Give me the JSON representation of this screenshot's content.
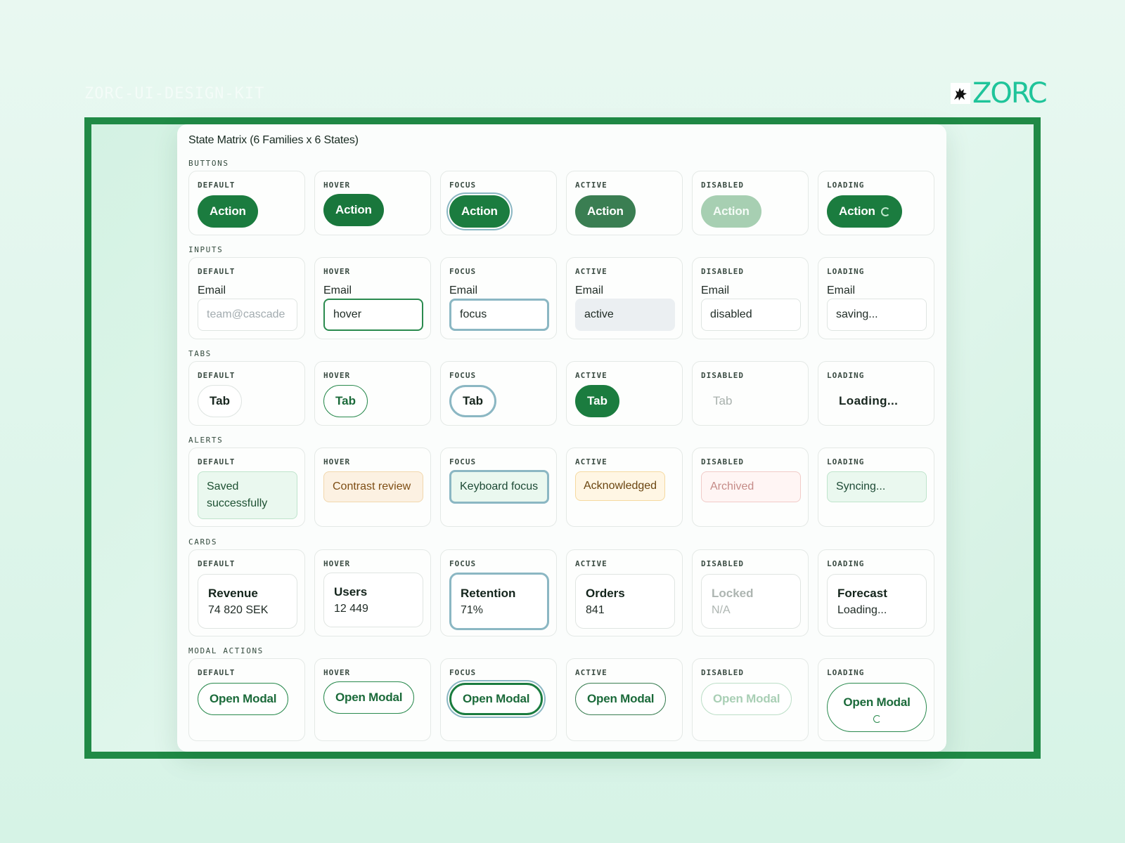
{
  "kit_title": "ZORC-UI-DESIGN-KIT",
  "logo": {
    "text": "ZORC",
    "icon": "creature-icon",
    "color": "#1fc49a"
  },
  "colors": {
    "frame": "#208a46",
    "primary": "#1b7c3f",
    "focus_ring": "#8bb7c3"
  },
  "matrix": {
    "title": "State Matrix (6 Families x 6 States)",
    "states": [
      "DEFAULT",
      "HOVER",
      "FOCUS",
      "ACTIVE",
      "DISABLED",
      "LOADING"
    ],
    "buttons": {
      "label": "BUTTONS",
      "items": [
        "Action",
        "Action",
        "Action",
        "Action",
        "Action",
        "Action"
      ]
    },
    "inputs": {
      "label": "INPUTS",
      "field_label": "Email",
      "placeholder": "team@cascade",
      "values": [
        "",
        "hover",
        "focus",
        "active",
        "disabled",
        "saving..."
      ]
    },
    "tabs": {
      "label": "TABS",
      "items": [
        "Tab",
        "Tab",
        "Tab",
        "Tab",
        "Tab",
        "Loading..."
      ]
    },
    "alerts": {
      "label": "ALERTS",
      "items": [
        "Saved successfully",
        "Contrast review",
        "Keyboard focus",
        "Acknowledged",
        "Archived",
        "Syncing..."
      ]
    },
    "cards": {
      "label": "CARDS",
      "items": [
        {
          "title": "Revenue",
          "value": "74 820 SEK"
        },
        {
          "title": "Users",
          "value": "12 449"
        },
        {
          "title": "Retention",
          "value": "71%"
        },
        {
          "title": "Orders",
          "value": "841"
        },
        {
          "title": "Locked",
          "value": "N/A"
        },
        {
          "title": "Forecast",
          "value": "Loading..."
        }
      ]
    },
    "modal_actions": {
      "label": "MODAL ACTIONS",
      "items": [
        "Open Modal",
        "Open Modal",
        "Open Modal",
        "Open Modal",
        "Open Modal",
        "Open Modal"
      ]
    }
  }
}
